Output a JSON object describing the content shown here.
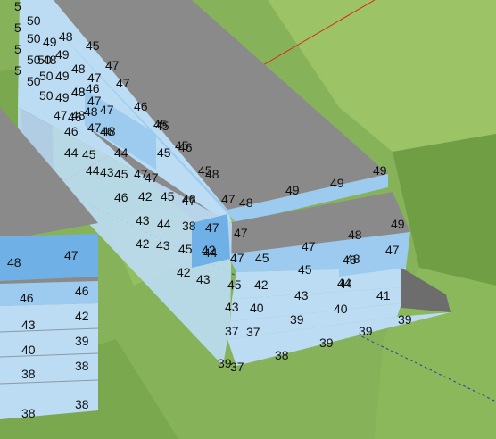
{
  "viewport": {
    "name": "3d-building-viewport"
  },
  "colors": {
    "terrain_light": "#9cc466",
    "terrain_mid": "#86b35a",
    "terrain_dark": "#6f9e44",
    "roof": "#8a8a8a",
    "roof_shadow": "#6d6d6d",
    "floor_light": "#bcdcf4",
    "floor_mid": "#9ccbef",
    "floor_dark": "#6fb0e6",
    "wall_shadow": "#4a4a4a",
    "axis_red": "#d42a1c",
    "axis_green": "#37b44a",
    "axis_blue": "#2b3fa8"
  },
  "labels": {
    "right_building": [
      "49",
      "49",
      "48",
      "47",
      "48",
      "49",
      "47",
      "49",
      "47",
      "48",
      "46",
      "47",
      "45",
      "47",
      "44",
      "46",
      "45",
      "42",
      "44",
      "41",
      "45",
      "43",
      "40",
      "40",
      "39",
      "43",
      "37",
      "38",
      "39",
      "39",
      "39",
      "37",
      "39",
      "37",
      "38",
      "45",
      "46",
      "42",
      "47",
      "44",
      "45",
      "43",
      "42",
      "43",
      "44",
      "45",
      "43",
      "42",
      "48",
      "47",
      "46",
      "45",
      "44",
      "43",
      "42",
      "48",
      "47",
      "46",
      "45",
      "44",
      "48",
      "47",
      "46",
      "45",
      "47",
      "46",
      "45",
      "44",
      "45",
      "46",
      "47",
      "48",
      "45",
      "47",
      "46",
      "50",
      "49",
      "48",
      "47",
      "50",
      "49",
      "48",
      "47",
      "50",
      "49",
      "48",
      "47",
      "5",
      "50",
      "50",
      "49",
      "48",
      "5",
      "50",
      "5",
      "48",
      "50",
      "5",
      "45",
      "47"
    ],
    "left_building": [
      "48",
      "47",
      "46",
      "46",
      "43",
      "42",
      "40",
      "39",
      "38",
      "38",
      "38",
      "38"
    ]
  }
}
